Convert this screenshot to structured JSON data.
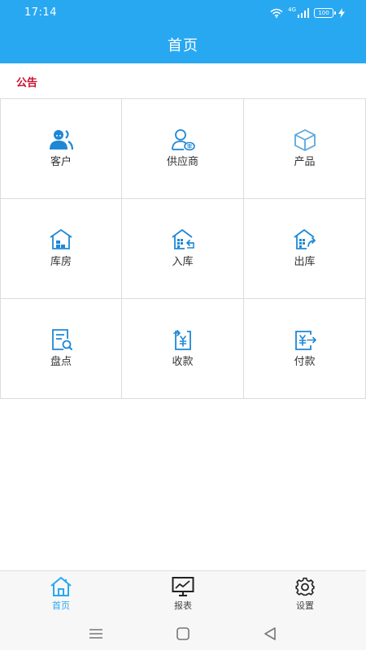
{
  "status_bar": {
    "time": "17:14",
    "signal_label": "4G",
    "battery_level": "100"
  },
  "header": {
    "title": "首页"
  },
  "notice": {
    "label": "公告"
  },
  "menu": {
    "items": [
      {
        "label": "客户",
        "icon": "customer-icon"
      },
      {
        "label": "供应商",
        "icon": "supplier-icon"
      },
      {
        "label": "产品",
        "icon": "product-icon"
      },
      {
        "label": "库房",
        "icon": "warehouse-icon"
      },
      {
        "label": "入库",
        "icon": "stock-in-icon"
      },
      {
        "label": "出库",
        "icon": "stock-out-icon"
      },
      {
        "label": "盘点",
        "icon": "inventory-check-icon"
      },
      {
        "label": "收款",
        "icon": "receive-payment-icon"
      },
      {
        "label": "付款",
        "icon": "make-payment-icon"
      }
    ]
  },
  "tabs": [
    {
      "label": "首页",
      "icon": "home-icon",
      "active": true
    },
    {
      "label": "报表",
      "icon": "report-monitor-icon",
      "active": false
    },
    {
      "label": "设置",
      "icon": "gear-icon",
      "active": false
    }
  ],
  "colors": {
    "brand": "#29a8f2",
    "notice": "#c8102e",
    "icon": "#1e88d6",
    "cell_border": "#dcdcdc"
  }
}
